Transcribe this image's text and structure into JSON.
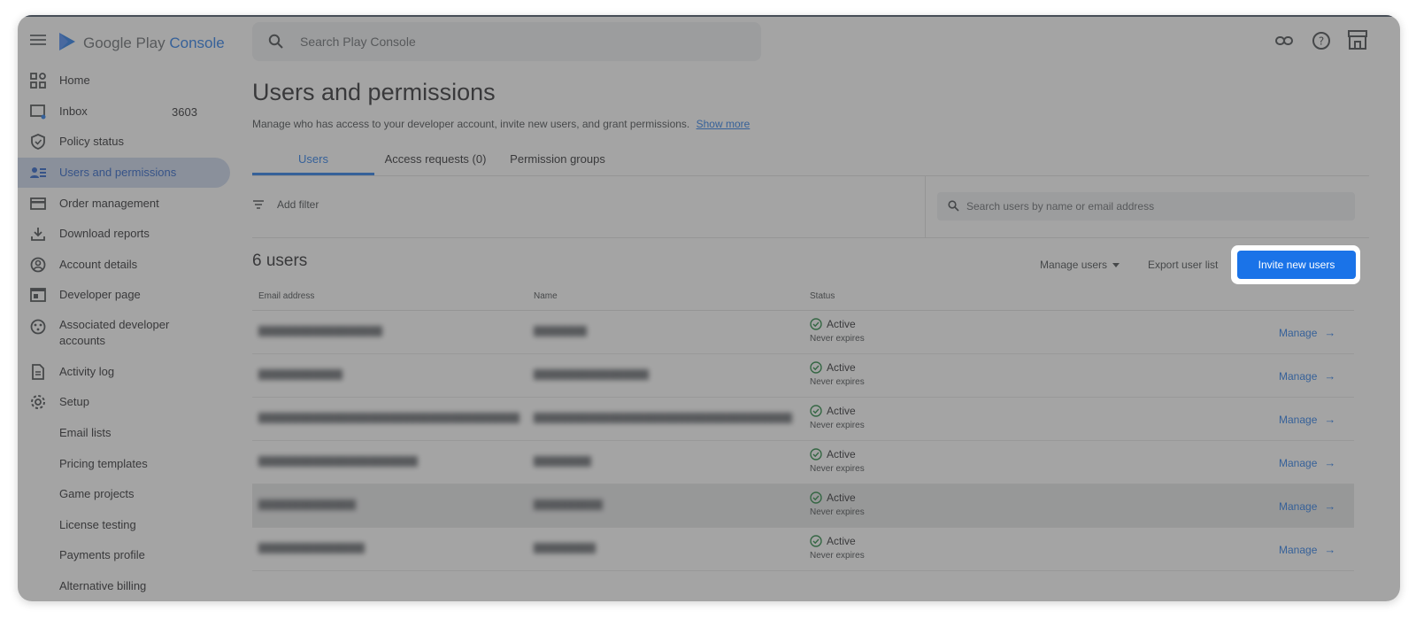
{
  "app": {
    "logo_text_main": "Google Play",
    "logo_text_accent": "Console"
  },
  "search": {
    "placeholder": "Search Play Console"
  },
  "sidebar": {
    "items": [
      {
        "label": "Home",
        "icon": "grid-icon"
      },
      {
        "label": "Inbox",
        "icon": "inbox-icon",
        "badge": "3603"
      },
      {
        "label": "Policy status",
        "icon": "shield-icon"
      },
      {
        "label": "Users and permissions",
        "icon": "users-icon",
        "active": true
      },
      {
        "label": "Order management",
        "icon": "credit-card-icon"
      },
      {
        "label": "Download reports",
        "icon": "download-icon"
      },
      {
        "label": "Account details",
        "icon": "account-icon"
      },
      {
        "label": "Developer page",
        "icon": "web-icon"
      },
      {
        "label": "Associated developer accounts",
        "icon": "linked-accounts-icon"
      },
      {
        "label": "Activity log",
        "icon": "document-icon"
      },
      {
        "label": "Setup",
        "icon": "gear-icon"
      }
    ],
    "sub_items": [
      {
        "label": "Email lists"
      },
      {
        "label": "Pricing templates"
      },
      {
        "label": "Game projects"
      },
      {
        "label": "License testing"
      },
      {
        "label": "Payments profile"
      },
      {
        "label": "Alternative billing"
      }
    ]
  },
  "page": {
    "title": "Users and permissions",
    "subtitle": "Manage who has access to your developer account, invite new users, and grant permissions.",
    "show_more": "Show more"
  },
  "tabs": [
    {
      "label": "Users",
      "active": true
    },
    {
      "label": "Access requests (0)"
    },
    {
      "label": "Permission groups"
    }
  ],
  "filter": {
    "label": "Add filter",
    "user_search_placeholder": "Search users by name or email address"
  },
  "users_section": {
    "count_title": "6 users",
    "manage_users": "Manage users",
    "export": "Export user list",
    "invite": "Invite new users"
  },
  "table": {
    "headers": [
      "Email address",
      "Name",
      "Status"
    ],
    "rows": [
      {
        "email": "",
        "name": "",
        "status": "Active",
        "expiry": "Never expires",
        "action": "Manage"
      },
      {
        "email": "",
        "name": "",
        "status": "Active",
        "expiry": "Never expires",
        "action": "Manage"
      },
      {
        "email": "",
        "name": "",
        "status": "Active",
        "expiry": "Never expires",
        "action": "Manage"
      },
      {
        "email": "",
        "name": "",
        "status": "Active",
        "expiry": "Never expires",
        "action": "Manage"
      },
      {
        "email": "",
        "name": "",
        "status": "Active",
        "expiry": "Never expires",
        "action": "Manage"
      },
      {
        "email": "",
        "name": "",
        "status": "Active",
        "expiry": "Never expires",
        "action": "Manage"
      }
    ]
  },
  "colors": {
    "accent": "#1a73e8",
    "overlay": "rgba(80,80,80,0.52)"
  }
}
